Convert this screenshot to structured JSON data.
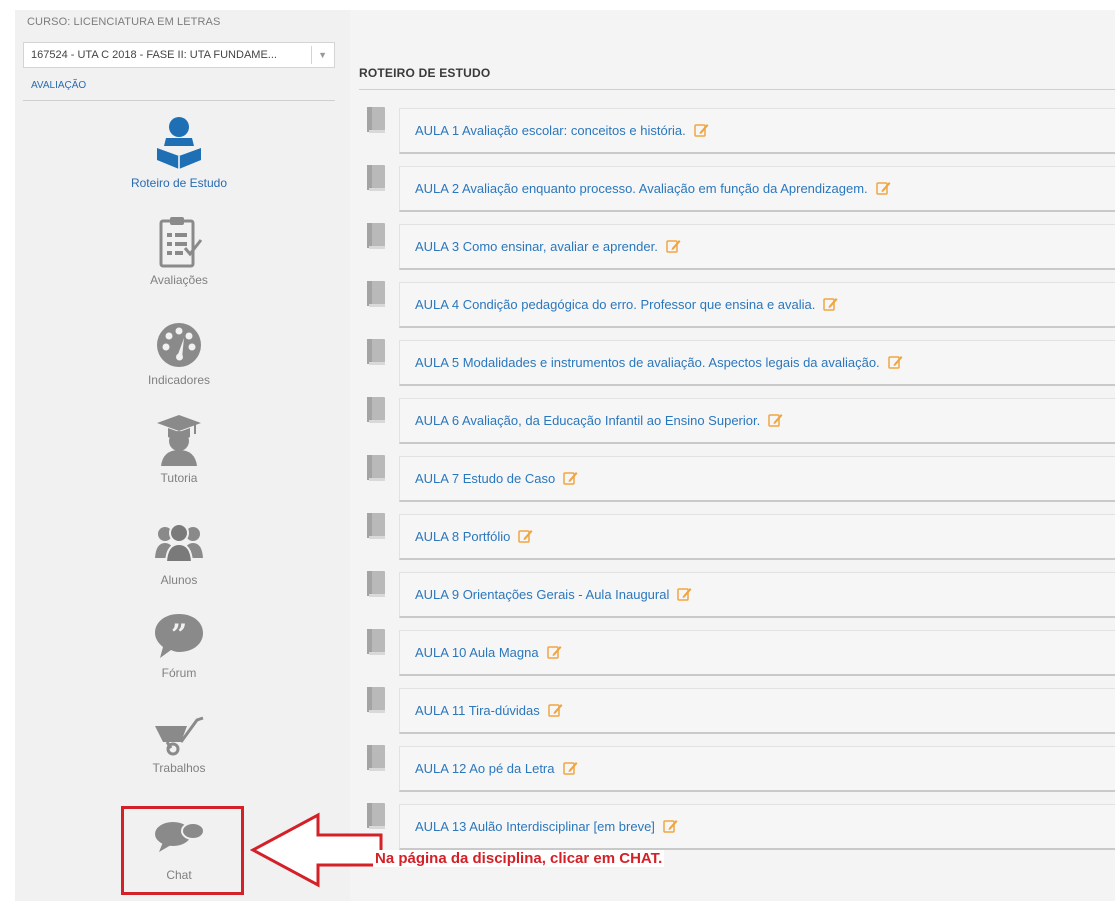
{
  "course": {
    "label": "CURSO: LICENCIATURA EM LETRAS",
    "selected": "167524 - UTA C 2018 - FASE II: UTA FUNDAME...",
    "discipline": "AVALIAÇÃO"
  },
  "nav": [
    {
      "label": "Roteiro de Estudo",
      "icon": "study-guide-icon",
      "active": true
    },
    {
      "label": "Avaliações",
      "icon": "clipboard-checklist-icon",
      "active": false
    },
    {
      "label": "Indicadores",
      "icon": "speedometer-icon",
      "active": false
    },
    {
      "label": "Tutoria",
      "icon": "graduate-tutor-icon",
      "active": false
    },
    {
      "label": "Alunos",
      "icon": "students-group-icon",
      "active": false
    },
    {
      "label": "Fórum",
      "icon": "quote-bubble-icon",
      "active": false
    },
    {
      "label": "Trabalhos",
      "icon": "wheelbarrow-icon",
      "active": false
    },
    {
      "label": "Chat",
      "icon": "chat-bubbles-icon",
      "active": false
    }
  ],
  "roteiro": {
    "title": "ROTEIRO DE ESTUDO",
    "lessons": [
      {
        "text": "AULA 1  Avaliação escolar: conceitos e história."
      },
      {
        "text": "AULA 2  Avaliação enquanto processo. Avaliação em função da Aprendizagem."
      },
      {
        "text": "AULA 3  Como ensinar, avaliar e aprender."
      },
      {
        "text": "AULA 4  Condição pedagógica do erro. Professor que ensina e avalia."
      },
      {
        "text": "AULA 5  Modalidades e instrumentos de avaliação. Aspectos legais da avaliação."
      },
      {
        "text": "AULA 6  Avaliação, da Educação Infantil ao Ensino Superior."
      },
      {
        "text": "AULA 7  Estudo de Caso"
      },
      {
        "text": "AULA 8  Portfólio"
      },
      {
        "text": "AULA 9  Orientações Gerais - Aula Inaugural"
      },
      {
        "text": "AULA 10  Aula Magna"
      },
      {
        "text": "AULA 11  Tira-dúvidas"
      },
      {
        "text": "AULA 12  Ao pé da Letra"
      },
      {
        "text": "AULA 13  Aulão Interdisciplinar [em breve]"
      }
    ]
  },
  "annotation": {
    "text": "Na página da disciplina, clicar em CHAT.",
    "color": "#d42027"
  },
  "colors": {
    "accent": "#2b77bd",
    "edit_icon": "#f0a640",
    "icon_gray": "#8a8a8a"
  }
}
